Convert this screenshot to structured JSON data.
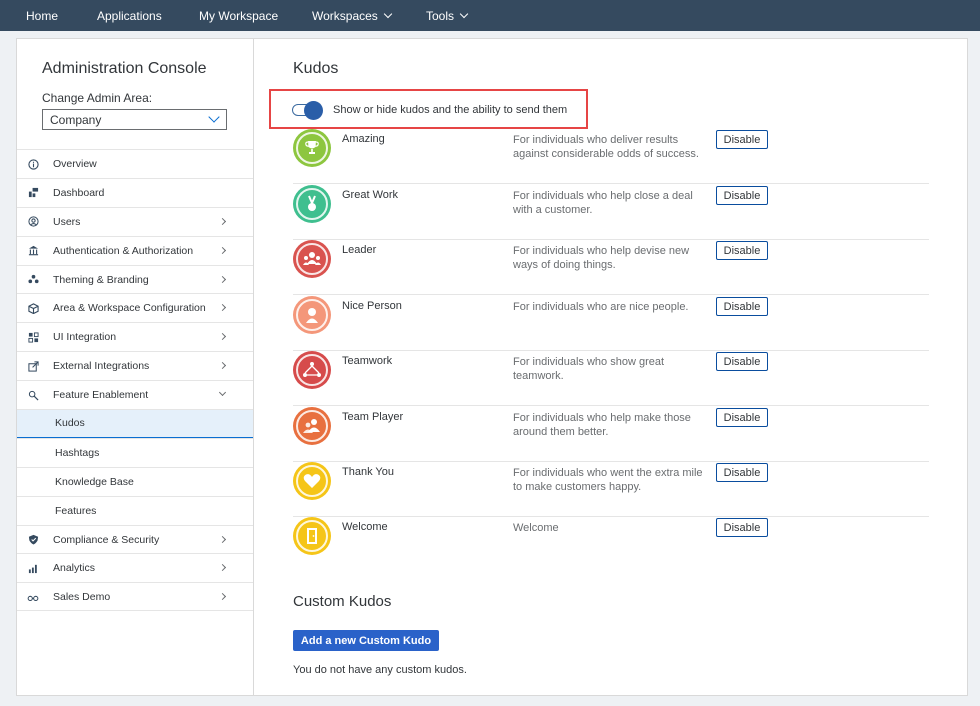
{
  "nav": {
    "home": "Home",
    "applications": "Applications",
    "my_workspace": "My Workspace",
    "workspaces": "Workspaces",
    "tools": "Tools"
  },
  "sidebar": {
    "title": "Administration Console",
    "change_label": "Change Admin Area:",
    "selected_area": "Company",
    "items": [
      {
        "label": "Overview",
        "icon": "info-icon",
        "arrow": false
      },
      {
        "label": "Dashboard",
        "icon": "dashboard-icon",
        "arrow": false
      },
      {
        "label": "Users",
        "icon": "user-icon",
        "arrow": true
      },
      {
        "label": "Authentication & Authorization",
        "icon": "building-icon",
        "arrow": true
      },
      {
        "label": "Theming & Branding",
        "icon": "palette-icon",
        "arrow": true
      },
      {
        "label": "Area & Workspace Configuration",
        "icon": "cube-icon",
        "arrow": true
      },
      {
        "label": "UI Integration",
        "icon": "ui-grid-icon",
        "arrow": true
      },
      {
        "label": "External Integrations",
        "icon": "external-icon",
        "arrow": true
      },
      {
        "label": "Feature Enablement",
        "icon": "feature-icon",
        "arrow": true
      },
      {
        "label": "Kudos"
      },
      {
        "label": "Hashtags"
      },
      {
        "label": "Knowledge Base"
      },
      {
        "label": "Features"
      },
      {
        "label": "Compliance & Security",
        "icon": "shield-icon",
        "arrow": true
      },
      {
        "label": "Analytics",
        "icon": "bar-chart-icon",
        "arrow": true
      },
      {
        "label": "Sales Demo",
        "icon": "glasses-icon",
        "arrow": true
      }
    ]
  },
  "main": {
    "title": "Kudos",
    "toggle_label": "Show or hide kudos and the ability to send them",
    "toggle_on": true,
    "disable_label": "Disable",
    "kudos": [
      {
        "name": "Amazing",
        "desc": "For individuals who deliver results against considerable odds of success.",
        "color": "#8dc63f",
        "icon": "trophy-icon"
      },
      {
        "name": "Great Work",
        "desc": "For individuals who help close a deal with a customer.",
        "color": "#3fbf8f",
        "icon": "medal-icon"
      },
      {
        "name": "Leader",
        "desc": "For individuals who help devise new ways of doing things.",
        "color": "#d9534f",
        "icon": "leader-icon"
      },
      {
        "name": "Nice Person",
        "desc": "For individuals who are nice people.",
        "color": "#f4977a",
        "icon": "person-icon"
      },
      {
        "name": "Teamwork",
        "desc": "For individuals who show great teamwork.",
        "color": "#d64b4b",
        "icon": "teamwork-icon"
      },
      {
        "name": "Team Player",
        "desc": "For individuals who help make those around them better.",
        "color": "#e8703f",
        "icon": "team-player-icon"
      },
      {
        "name": "Thank You",
        "desc": "For individuals who went the extra mile to make customers happy.",
        "color": "#f5c518",
        "icon": "heart-icon"
      },
      {
        "name": "Welcome",
        "desc": "Welcome",
        "color": "#f5c518",
        "icon": "door-icon"
      }
    ],
    "custom_title": "Custom Kudos",
    "add_button": "Add a new Custom Kudo",
    "no_custom": "You do not have any custom kudos."
  }
}
